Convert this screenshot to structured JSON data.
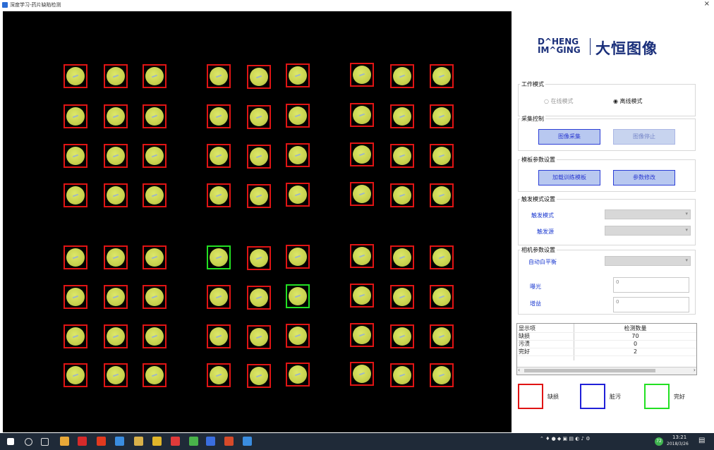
{
  "window": {
    "title": "深度学习-药片缺陷检测",
    "close_glyph": "×"
  },
  "cells": [
    {
      "s": "bad"
    },
    {
      "s": "bad"
    },
    {
      "s": "bad"
    },
    {
      "s": "bad"
    },
    {
      "s": "bad"
    },
    {
      "s": "bad"
    },
    {
      "s": "bad"
    },
    {
      "s": "bad"
    },
    {
      "s": "bad"
    },
    {
      "s": "bad"
    },
    {
      "s": "bad"
    },
    {
      "s": "bad"
    },
    {
      "s": "bad"
    },
    {
      "s": "bad"
    },
    {
      "s": "bad"
    },
    {
      "s": "bad"
    },
    {
      "s": "bad"
    },
    {
      "s": "bad"
    },
    {
      "s": "bad"
    },
    {
      "s": "bad"
    },
    {
      "s": "bad"
    },
    {
      "s": "bad"
    },
    {
      "s": "bad"
    },
    {
      "s": "bad"
    },
    {
      "s": "bad"
    },
    {
      "s": "bad"
    },
    {
      "s": "bad"
    },
    {
      "s": "bad"
    },
    {
      "s": "bad"
    },
    {
      "s": "bad"
    },
    {
      "s": "bad"
    },
    {
      "s": "bad"
    },
    {
      "s": "bad"
    },
    {
      "s": "bad"
    },
    {
      "s": "bad"
    },
    {
      "s": "bad"
    },
    {
      "s": "bad"
    },
    {
      "s": "bad"
    },
    {
      "s": "bad"
    },
    {
      "s": "good"
    },
    {
      "s": "bad"
    },
    {
      "s": "bad"
    },
    {
      "s": "bad"
    },
    {
      "s": "bad"
    },
    {
      "s": "bad"
    },
    {
      "s": "bad"
    },
    {
      "s": "bad"
    },
    {
      "s": "bad"
    },
    {
      "s": "bad"
    },
    {
      "s": "bad"
    },
    {
      "s": "good"
    },
    {
      "s": "bad"
    },
    {
      "s": "bad"
    },
    {
      "s": "bad"
    },
    {
      "s": "bad"
    },
    {
      "s": "bad"
    },
    {
      "s": "bad"
    },
    {
      "s": "bad"
    },
    {
      "s": "bad"
    },
    {
      "s": "bad"
    },
    {
      "s": "bad"
    },
    {
      "s": "bad"
    },
    {
      "s": "bad"
    },
    {
      "s": "bad"
    },
    {
      "s": "bad"
    },
    {
      "s": "bad"
    },
    {
      "s": "bad"
    },
    {
      "s": "bad"
    },
    {
      "s": "bad"
    },
    {
      "s": "bad"
    },
    {
      "s": "bad"
    },
    {
      "s": "bad"
    }
  ],
  "logo": {
    "mark_line1": "D^HENG",
    "mark_line2": "IM^GING",
    "cn": "大恒图像"
  },
  "work_mode": {
    "legend": "工作模式",
    "online": "在线模式",
    "offline": "离线模式",
    "selected": "offline"
  },
  "capture": {
    "legend": "采集控制",
    "start": "图像采集",
    "stop": "图像停止"
  },
  "template": {
    "legend": "模板参数设置",
    "train": "加载训练模板",
    "modify": "参数修改"
  },
  "trigger": {
    "legend": "触发模式设置",
    "mode_label": "触发模式",
    "source_label": "触发源",
    "mode_value": "",
    "source_value": ""
  },
  "camera": {
    "legend": "相机参数设置",
    "wb_label": "自动白平衡",
    "exposure_label": "曝光",
    "gain_label": "增益",
    "wb_value": "",
    "exposure_value": "0",
    "gain_value": "0"
  },
  "results": {
    "col1": "显示项",
    "col2": "检测数量",
    "rows": [
      {
        "name": "缺损",
        "count": "70"
      },
      {
        "name": "污渍",
        "count": "0"
      },
      {
        "name": "完好",
        "count": "2"
      }
    ]
  },
  "legend_keys": [
    {
      "label": "缺损",
      "color": "#e01414"
    },
    {
      "label": "脏污",
      "color": "#2020d8"
    },
    {
      "label": "完好",
      "color": "#22e022"
    }
  ],
  "taskbar": {
    "icons": [
      "windows-start-icon",
      "search-icon",
      "task-view-icon",
      "app-icon",
      "app-icon",
      "app-icon",
      "app-icon",
      "app-icon",
      "app-icon",
      "app-icon",
      "app-icon",
      "app-icon",
      "app-icon",
      "app-icon",
      "app-icon"
    ],
    "icon_colors": [
      "#ffffff",
      "#dddddd",
      "#dddddd",
      "#e8a838",
      "#d62a2a",
      "#e23a1f",
      "#3a8de0",
      "#d8b14a",
      "#e0b62a",
      "#e03a3a",
      "#49b34a",
      "#3a6ee0",
      "#d64a2a",
      "#3a8de0",
      "#3a8de0"
    ],
    "time": "13:21",
    "date": "2018/3/26",
    "tray_badge": "72"
  }
}
